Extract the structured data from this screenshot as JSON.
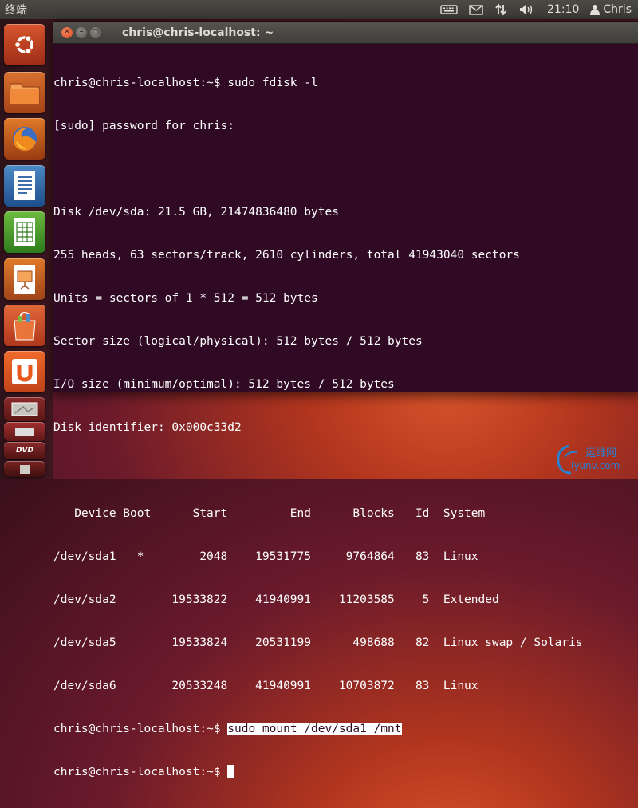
{
  "top_panel": {
    "title": "终端",
    "time": "21:10",
    "user": "Chris",
    "icons": [
      "keyboard-icon",
      "mail-icon",
      "network-icon",
      "volume-icon",
      "user-icon"
    ]
  },
  "launcher": {
    "items": [
      "ubuntu-logo",
      "home-folder",
      "firefox",
      "libreoffice-writer",
      "libreoffice-calc",
      "libreoffice-impress",
      "ubuntu-software-center",
      "ubuntu-one",
      "workspace-switcher",
      "trash"
    ],
    "dvd_label": "DVD"
  },
  "window": {
    "title": "chris@chris-localhost: ~"
  },
  "terminal": {
    "lines": [
      "chris@chris-localhost:~$ sudo fdisk -l",
      "[sudo] password for chris:",
      "",
      "Disk /dev/sda: 21.5 GB, 21474836480 bytes",
      "255 heads, 63 sectors/track, 2610 cylinders, total 41943040 sectors",
      "Units = sectors of 1 * 512 = 512 bytes",
      "Sector size (logical/physical): 512 bytes / 512 bytes",
      "I/O size (minimum/optimal): 512 bytes / 512 bytes",
      "Disk identifier: 0x000c33d2",
      "",
      "   Device Boot      Start         End      Blocks   Id  System",
      "/dev/sda1   *        2048    19531775     9764864   83  Linux",
      "/dev/sda2        19533822    41940991    11203585    5  Extended",
      "/dev/sda5        19533824    20531199      498688   82  Linux swap / Solaris",
      "/dev/sda6        20533248    41940991    10703872   83  Linux"
    ],
    "prompt": "chris@chris-localhost:~$ ",
    "selected_command": "sudo mount /dev/sda1 /mnt"
  },
  "watermark": {
    "text_top": "运维网",
    "text_bottom": "iyunv.com"
  }
}
